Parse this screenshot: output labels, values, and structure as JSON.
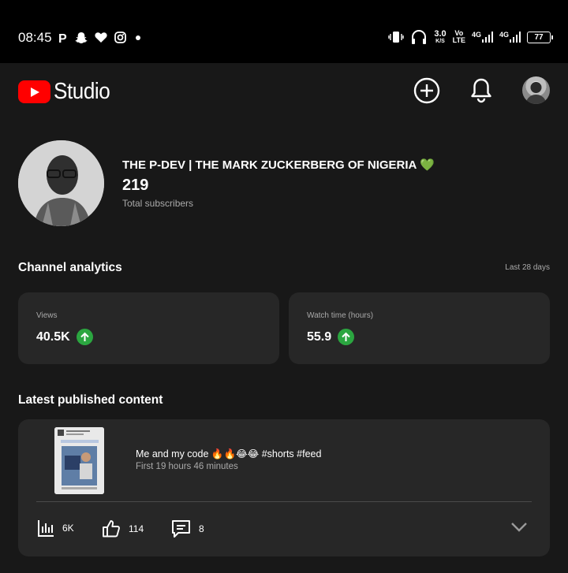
{
  "status_bar": {
    "time": "08:45",
    "left_icons": [
      "pinterest-icon",
      "snapchat-icon",
      "heart-icon",
      "instagram-icon",
      "dot-icon"
    ],
    "speed_value": "3.0",
    "speed_unit": "K/S",
    "volte_top": "Vo",
    "volte_bottom": "LTE",
    "net1": "4G",
    "net2": "4G",
    "battery": "77"
  },
  "app_bar": {
    "title": "Studio",
    "icons": [
      "youtube-logo-icon",
      "create-icon",
      "notifications-icon",
      "account-avatar"
    ]
  },
  "channel": {
    "name": "THE P-DEV | THE MARK ZUCKERBERG OF NIGERIA",
    "name_emoji": "💚",
    "subscribers": "219",
    "subscribers_label": "Total subscribers"
  },
  "analytics": {
    "title": "Channel analytics",
    "period": "Last 28 days",
    "metrics": [
      {
        "label": "Views",
        "value": "40.5K",
        "trend": "up"
      },
      {
        "label": "Watch time (hours)",
        "value": "55.9",
        "trend": "up"
      }
    ],
    "trend_color": "#2ba640"
  },
  "latest": {
    "title": "Latest published content",
    "video": {
      "title": "Me and my code 🔥🔥😂😂 #shorts #feed",
      "meta": "First 19 hours 46 minutes",
      "views": "6K",
      "likes": "114",
      "comments": "8"
    }
  },
  "colors": {
    "background": "#181818",
    "card": "#272727",
    "brand_red": "#ff0000",
    "secondary_text": "#aaaaaa"
  }
}
